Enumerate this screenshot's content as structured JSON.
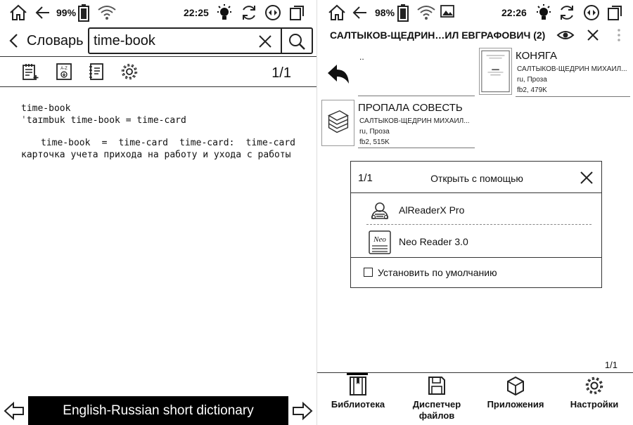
{
  "left": {
    "status": {
      "battery": "99%",
      "time": "22:25"
    },
    "header": {
      "title": "Словарь",
      "search_value": "time-book",
      "search_placeholder": ""
    },
    "toolbar": {
      "page": "1/1"
    },
    "entry": {
      "headword": "time-book",
      "transcription": "ˈtaɪmbuk time-book = time-card",
      "definition": "time-book = time-card time-card: time-card карточка учета прихода на работу и ухода с работы"
    },
    "dictionary_name": "English-Russian short dictionary"
  },
  "right": {
    "status": {
      "battery": "98%",
      "time": "22:26"
    },
    "header": {
      "title": "САЛТЫКОВ-ЩЕДРИН…ИЛ ЕВГРАФОВИЧ (2)"
    },
    "updir": "..",
    "books": [
      {
        "title": "КОНЯГА",
        "author": "САЛТЫКОВ-ЩЕДРИН МИХАИЛ...",
        "lang_genre": "ru, Проза",
        "format_size": "fb2, 479K"
      },
      {
        "title": "ПРОПАЛА СОВЕСТЬ",
        "author": "САЛТЫКОВ-ЩЕДРИН МИХАИЛ...",
        "lang_genre": "ru, Проза",
        "format_size": "fb2, 515K"
      }
    ],
    "dialog": {
      "count": "1/1",
      "title": "Открыть с помощью",
      "apps": [
        {
          "name": "AlReaderX Pro"
        },
        {
          "name": "Neo Reader 3.0"
        }
      ],
      "default_label": "Установить по умолчанию"
    },
    "page": "1/1",
    "nav": [
      {
        "label": "Библиотека"
      },
      {
        "label": "Диспетчер файлов"
      },
      {
        "label": "Приложения"
      },
      {
        "label": "Настройки"
      }
    ]
  }
}
